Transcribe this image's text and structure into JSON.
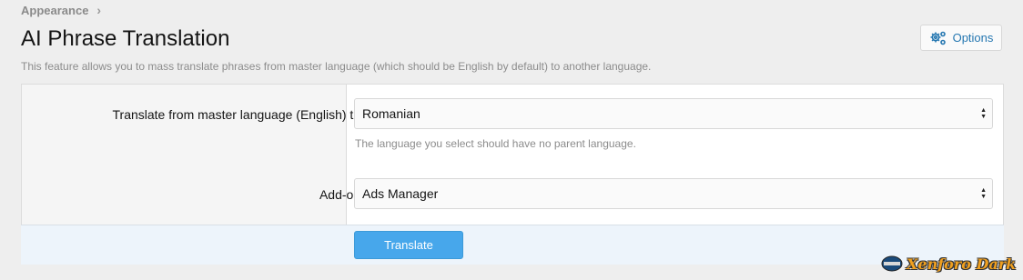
{
  "breadcrumb": {
    "item": "Appearance",
    "separator": "›"
  },
  "page": {
    "title": "AI Phrase Translation",
    "description": "This feature allows you to mass translate phrases from master language (which should be English by default) to another language."
  },
  "options_button": {
    "label": "Options",
    "icon": "gears-icon"
  },
  "form": {
    "language": {
      "label": "Translate from master language (English) to:",
      "value": "Romanian",
      "hint": "The language you select should have no parent language."
    },
    "addon": {
      "label": "Add-on:",
      "value": "Ads Manager"
    },
    "submit_label": "Translate"
  },
  "watermark": {
    "text": "Xenforo Dark"
  },
  "colors": {
    "accent": "#2577b1",
    "button": "#47a7eb",
    "submit_row": "#edf4fb",
    "background": "#eeeeee"
  }
}
